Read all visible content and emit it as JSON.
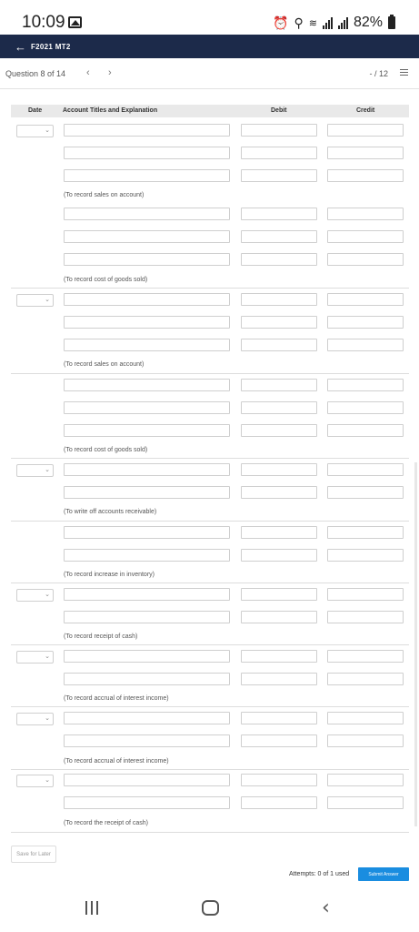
{
  "status_bar": {
    "time": "10:09",
    "battery_text": "82%",
    "icons": [
      "gallery-icon",
      "alarm-icon",
      "location-icon",
      "wifi-icon",
      "signal-icon",
      "signal-icon",
      "battery-icon"
    ]
  },
  "app_bar": {
    "back_icon": "arrow-left-icon",
    "title": "F2021 MT2"
  },
  "question_bar": {
    "question_text": "Question 8 of 14",
    "prev_label": "‹",
    "next_label": "›",
    "score": "- / 12",
    "list_icon": "list-icon"
  },
  "table": {
    "headers": {
      "date": "Date",
      "account": "Account Titles and Explanation",
      "debit": "Debit",
      "credit": "Credit"
    },
    "entries": [
      {
        "note": "(To record sales on account)",
        "rows": 3,
        "has_date": true
      },
      {
        "note": "(To record cost of goods sold)",
        "rows": 3,
        "has_date": false
      },
      {
        "note": "(To record sales on account)",
        "rows": 3,
        "has_date": true
      },
      {
        "note": "(To record cost of goods sold)",
        "rows": 3,
        "has_date": false
      },
      {
        "note": "(To write off accounts receivable)",
        "rows": 2,
        "has_date": true
      },
      {
        "note": "(To record increase in inventory)",
        "rows": 2,
        "has_date": false
      },
      {
        "note": "(To record receipt of cash)",
        "rows": 2,
        "has_date": true
      },
      {
        "note": "(To record accrual of interest income)",
        "rows": 2,
        "has_date": true
      },
      {
        "note": "(To record accrual of interest income)",
        "rows": 2,
        "has_date": true
      },
      {
        "note": "(To record the receipt of cash)",
        "rows": 2,
        "has_date": true
      }
    ]
  },
  "footer": {
    "save_later": "Save for Later",
    "attempts": "Attempts: 0 of 1 used",
    "submit": "Submit Answer"
  },
  "nav_bar": {
    "icons": [
      "recent-apps-icon",
      "home-icon",
      "back-icon"
    ]
  }
}
